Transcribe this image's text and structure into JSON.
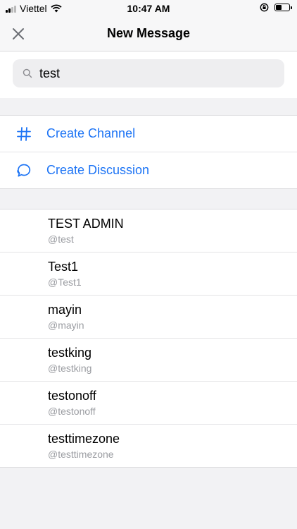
{
  "status": {
    "carrier": "Viettel",
    "time": "10:47 AM",
    "battery_level": 0.45
  },
  "nav": {
    "title": "New Message",
    "close_icon": "close-icon"
  },
  "search": {
    "value": "test",
    "icon": "search-icon"
  },
  "actions": [
    {
      "label": "Create Channel",
      "icon": "hash-icon"
    },
    {
      "label": "Create Discussion",
      "icon": "discussion-icon"
    }
  ],
  "users": [
    {
      "name": "TEST ADMIN",
      "username": "@test"
    },
    {
      "name": "Test1",
      "username": "@Test1"
    },
    {
      "name": "mayin",
      "username": "@mayin"
    },
    {
      "name": "testking",
      "username": "@testking"
    },
    {
      "name": "testonoff",
      "username": "@testonoff"
    },
    {
      "name": "testtimezone",
      "username": "@testtimezone"
    }
  ],
  "colors": {
    "accent": "#1d74f5",
    "secondary_text": "#9a9ca1",
    "background": "#f2f2f4"
  }
}
